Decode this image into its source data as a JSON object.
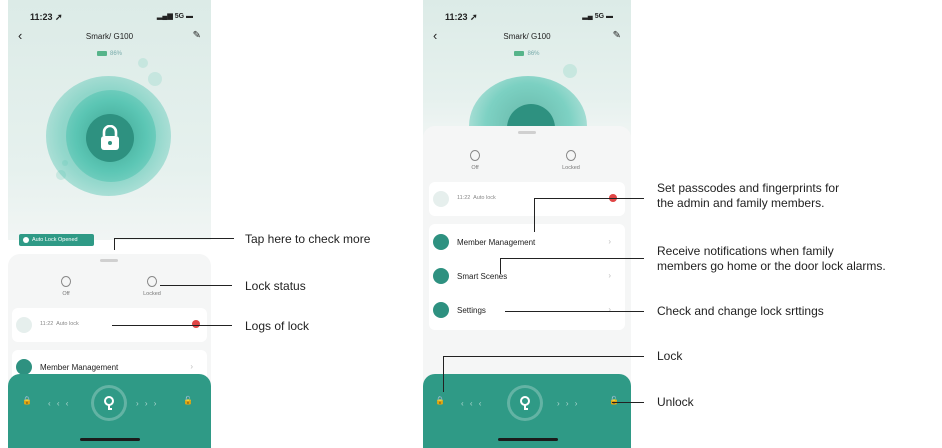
{
  "phone_left": {
    "status": {
      "time": "11:23 ➚",
      "network": "5G"
    },
    "title": "Smark/ G100",
    "battery": "86%",
    "toast": "Auto Lock Opened",
    "status_items": [
      {
        "label": "Off"
      },
      {
        "label": "Locked"
      }
    ],
    "log": {
      "time": "11:22",
      "text": "Auto lock"
    },
    "member_row": "Member Management",
    "annotations": {
      "more": "Tap here to check more",
      "lock_status": "Lock status",
      "logs": "Logs of lock"
    }
  },
  "phone_right": {
    "status": {
      "time": "11:23 ➚",
      "network": "5G"
    },
    "title": "Smark/ G100",
    "battery": "86%",
    "status_items": [
      {
        "label": "Off"
      },
      {
        "label": "Locked"
      }
    ],
    "log": {
      "time": "11:22",
      "text": "Auto lock"
    },
    "menu": [
      {
        "label": "Member Management",
        "icon": "member-icon"
      },
      {
        "label": "Smart Scenes",
        "icon": "toggle-icon"
      },
      {
        "label": "Settings",
        "icon": "gear-icon"
      }
    ],
    "annotations": {
      "members_1": "Set passcodes and fingerprints for",
      "members_2": "the admin and family members.",
      "scenes_1": "Receive notifications when family",
      "scenes_2": "members go home or the door lock alarms.",
      "settings": "Check and change lock srttings",
      "lock": "Lock",
      "unlock": "Unlock"
    }
  },
  "colors": {
    "accent": "#2f9a86",
    "alert": "#e04545",
    "sheet": "#f5f6f6"
  }
}
